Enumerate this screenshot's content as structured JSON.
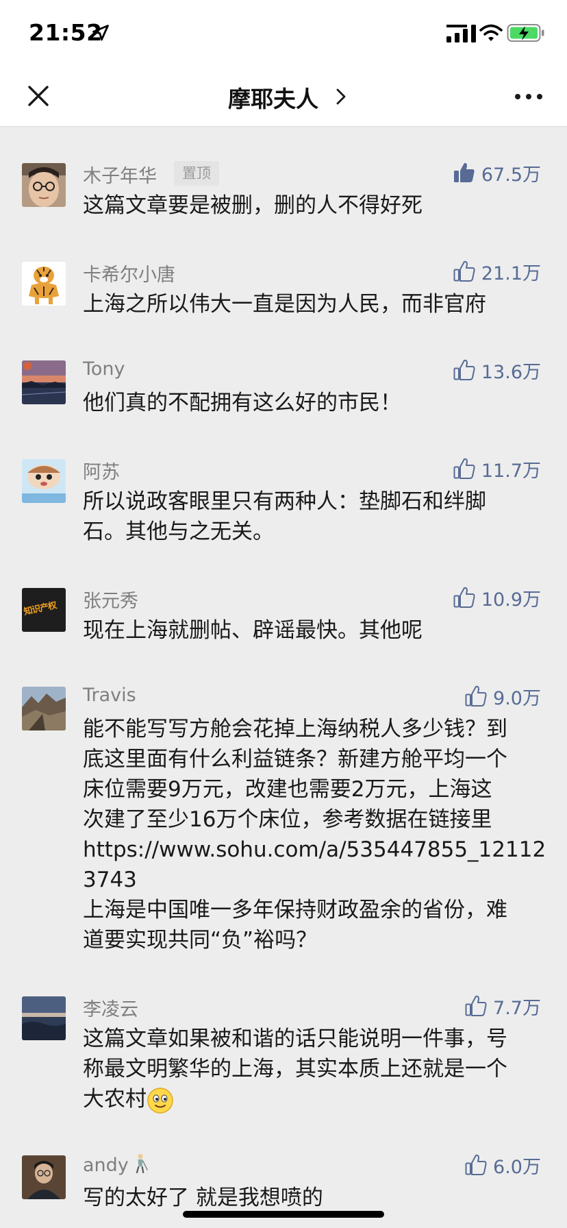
{
  "status_bar": {
    "time": "21:52"
  },
  "nav": {
    "title": "摩耶夫人"
  },
  "colors": {
    "like_blue": "#576b95",
    "background": "#ededed",
    "nickname_gray": "#7f7f7f"
  },
  "comments": [
    {
      "author": "木子年华",
      "badge": "置顶",
      "likes": "67.5万",
      "liked": true,
      "avatar_icon": "woman-glasses-avatar",
      "text": "这篇文章要是被删，删的人不得好死"
    },
    {
      "author": "卡希尔小唐",
      "likes": "21.1万",
      "avatar_icon": "tiger-cartoon-avatar",
      "text": "上海之所以伟大一直是因为人民，而非官府"
    },
    {
      "author": "Tony",
      "likes": "13.6万",
      "avatar_icon": "sunset-avatar",
      "text": "他们真的不配拥有这么好的市民！"
    },
    {
      "author": "阿苏",
      "likes": "11.7万",
      "avatar_icon": "cartoon-character-avatar",
      "text": "所以说政客眼里只有两种人：垫脚石和绊脚\n石。其他与之无关。"
    },
    {
      "author": "张元秀",
      "likes": "10.9万",
      "avatar_icon": "intellectual-property-avatar",
      "avatar_text": "知识产权",
      "text": "现在上海就删帖、辟谣最快。其他呢"
    },
    {
      "author": "Travis",
      "likes": "9.0万",
      "avatar_icon": "mountain-avatar",
      "text": "能不能写写方舱会花掉上海纳税人多少钱？到\n底这里面有什么利益链条？新建方舱平均一个\n床位需要9万元，改建也需要2万元，上海这\n次建了至少16万个床位，参考数据在链接里\nhttps://www.sohu.com/a/535447855_12112\n3743\n上海是中国唯一多年保持财政盈余的省份，难\n道要实现共同“负”裕吗？"
    },
    {
      "author": "李凌云",
      "likes": "7.7万",
      "avatar_icon": "sea-horizon-avatar",
      "text": "这篇文章如果被和谐的话只能说明一件事，号\n称最文明繁华的上海，其实本质上还就是一个\n大农村"
    },
    {
      "author": "andy",
      "likes": "6.0万",
      "avatar_icon": "man-portrait-avatar",
      "text": "写的太好了 就是我想喷的"
    }
  ]
}
